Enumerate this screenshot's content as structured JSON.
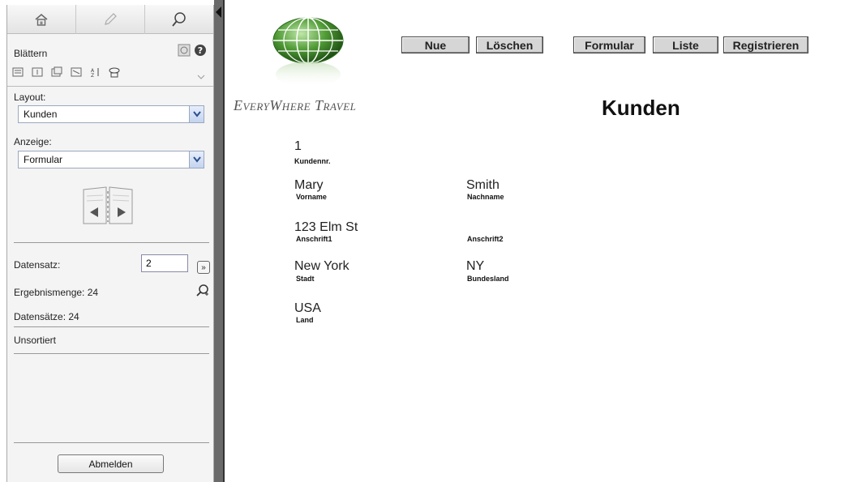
{
  "sidebar": {
    "tabs": [
      {
        "icon": "home-icon"
      },
      {
        "icon": "pencil-icon"
      },
      {
        "icon": "search-icon"
      }
    ],
    "mode_label": "Blättern",
    "layout_label": "Layout:",
    "layout_value": "Kunden",
    "view_label": "Anzeige:",
    "view_value": "Formular",
    "record_label": "Datensatz:",
    "record_value": "2",
    "found_set": "Ergebnismenge: 24",
    "total_records": "Datensätze: 24",
    "sort_status": "Unsortiert",
    "logout_label": "Abmelden"
  },
  "header": {
    "brand": "EveryWhere Travel",
    "buttons": {
      "new": "Nue",
      "delete": "Löschen",
      "form": "Formular",
      "list": "Liste",
      "register": "Registrieren"
    },
    "title": "Kunden"
  },
  "record": {
    "customer_no": {
      "value": "1",
      "label": "Kundennr."
    },
    "first_name": {
      "value": "Mary",
      "label": "Vorname"
    },
    "last_name": {
      "value": "Smith",
      "label": "Nachname"
    },
    "address1": {
      "value": "123 Elm St",
      "label": "Anschrift1"
    },
    "address2": {
      "value": "",
      "label": "Anschrift2"
    },
    "city": {
      "value": "New York",
      "label": "Stadt"
    },
    "state": {
      "value": "NY",
      "label": "Bundesland"
    },
    "country": {
      "value": "USA",
      "label": "Land"
    }
  },
  "colors": {
    "separator": "#6a6a6a",
    "button_bg": "#d6d6d6",
    "globe_green": "#3f8a2e"
  }
}
